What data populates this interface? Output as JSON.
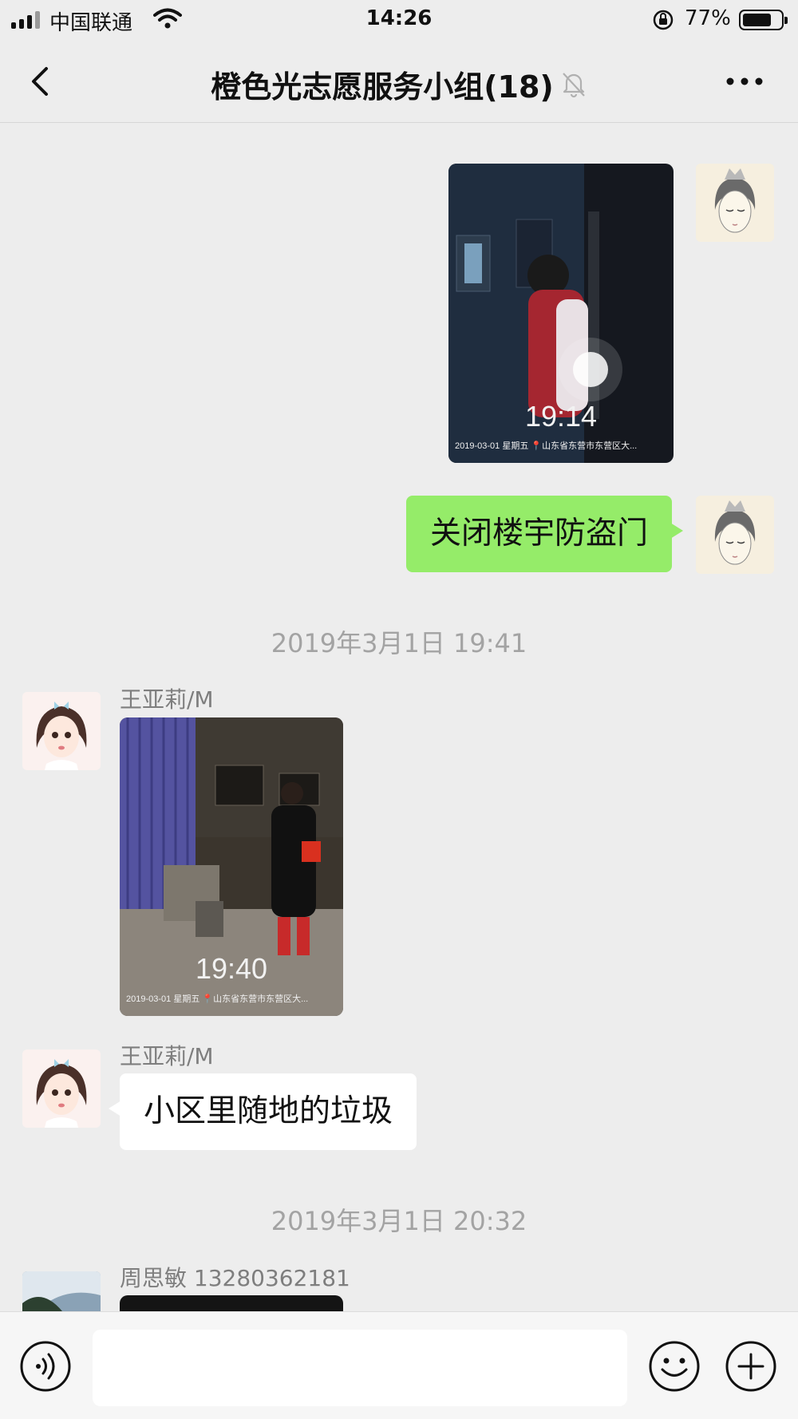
{
  "status_bar": {
    "carrier": "中国联通",
    "time": "14:26",
    "battery_percent": "77%",
    "battery_level": 0.77
  },
  "nav": {
    "title": "橙色光志愿服务小组(18)",
    "back_icon": "chevron-left-icon",
    "mute_icon": "bell-off-icon",
    "more_icon": "ellipsis-icon"
  },
  "messages": [
    {
      "type": "image",
      "side": "right",
      "photo_time": "19:14",
      "photo_info": "2019-03-01  星期五 📍山东省东营市东营区大..."
    },
    {
      "type": "text",
      "side": "right",
      "text": "关闭楼宇防盗门"
    },
    {
      "type": "timestamp",
      "text": "2019年3月1日 19:41"
    },
    {
      "type": "image",
      "side": "left",
      "sender": "王亚莉/M",
      "photo_time": "19:40",
      "photo_info": "2019-03-01  星期五 📍山东省东营市东营区大..."
    },
    {
      "type": "text",
      "side": "left",
      "sender": "王亚莉/M",
      "text": "小区里随地的垃圾"
    },
    {
      "type": "timestamp",
      "text": "2019年3月1日 20:32"
    },
    {
      "type": "image",
      "side": "left",
      "sender": "周思敏 13280362181"
    }
  ],
  "input_bar": {
    "voice_icon": "voice-icon",
    "emoji_icon": "emoji-icon",
    "plus_icon": "plus-circle-icon",
    "value": ""
  },
  "colors": {
    "background": "#ededed",
    "my_bubble": "#95ec69",
    "their_bubble": "#ffffff",
    "timestamp_text": "#a3a3a3"
  }
}
